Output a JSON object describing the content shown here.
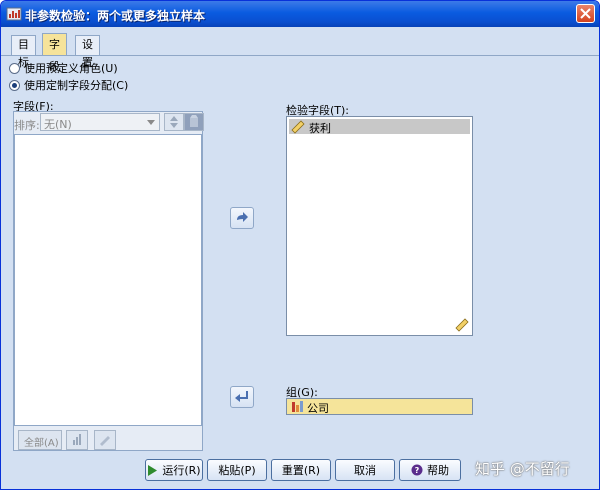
{
  "window": {
    "title": "非参数检验：两个或更多独立样本"
  },
  "tabs": [
    {
      "label": "目标"
    },
    {
      "label": "字段"
    },
    {
      "label": "设置"
    }
  ],
  "options": {
    "predefined_roles": "使用预定义角色(U)",
    "custom_assignments": "使用定制字段分配(C)"
  },
  "fields": {
    "label": "字段(F):",
    "sort_label": "排序:",
    "sort_value": "无(N)",
    "all_button": "全部(A)"
  },
  "test_fields": {
    "label": "检验字段(T):",
    "items": [
      "获利"
    ]
  },
  "groups": {
    "label": "组(G):",
    "value": "公司"
  },
  "buttons": {
    "run": "运行(R)",
    "paste": "粘贴(P)",
    "reset": "重置(R)",
    "cancel": "取消",
    "help": "帮助"
  },
  "watermark": "知乎 @不留行"
}
